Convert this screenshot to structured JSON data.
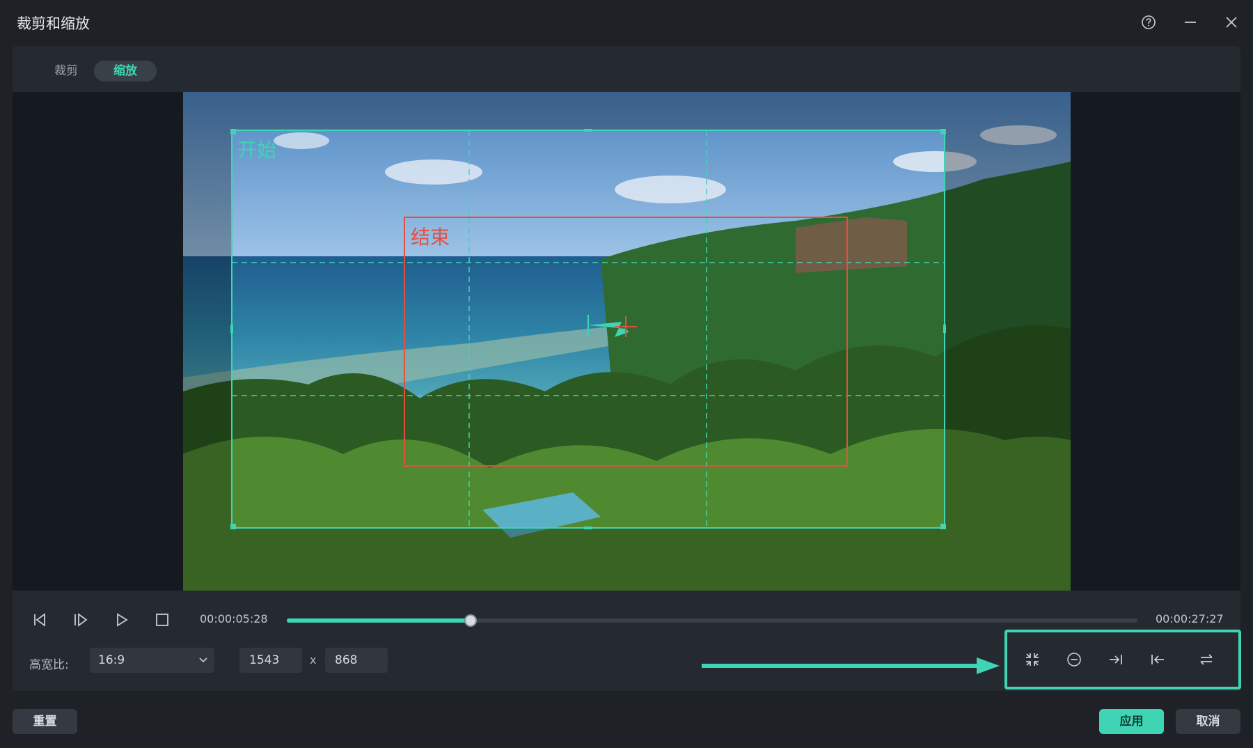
{
  "window": {
    "title": "裁剪和缩放"
  },
  "tabs": [
    {
      "label": "裁剪",
      "active": false
    },
    {
      "label": "缩放",
      "active": true
    }
  ],
  "preview": {
    "start_label": "开始",
    "end_label": "结束"
  },
  "playback": {
    "current_time": "00:00:05:28",
    "total_time": "00:00:27:27",
    "progress": 0.216
  },
  "aspect": {
    "label": "高宽比:",
    "value": "16:9",
    "width": "1543",
    "separator": "x",
    "height": "868"
  },
  "toolbox": {
    "icons": [
      "fit-icon",
      "zoom-out-icon",
      "move-to-end-icon",
      "move-to-start-icon",
      "swap-icon"
    ]
  },
  "footer": {
    "reset_label": "重置",
    "apply_label": "应用",
    "cancel_label": "取消"
  },
  "colors": {
    "accent": "#3fd5b4",
    "end_frame": "#e4503f",
    "background": "#1e2126"
  }
}
